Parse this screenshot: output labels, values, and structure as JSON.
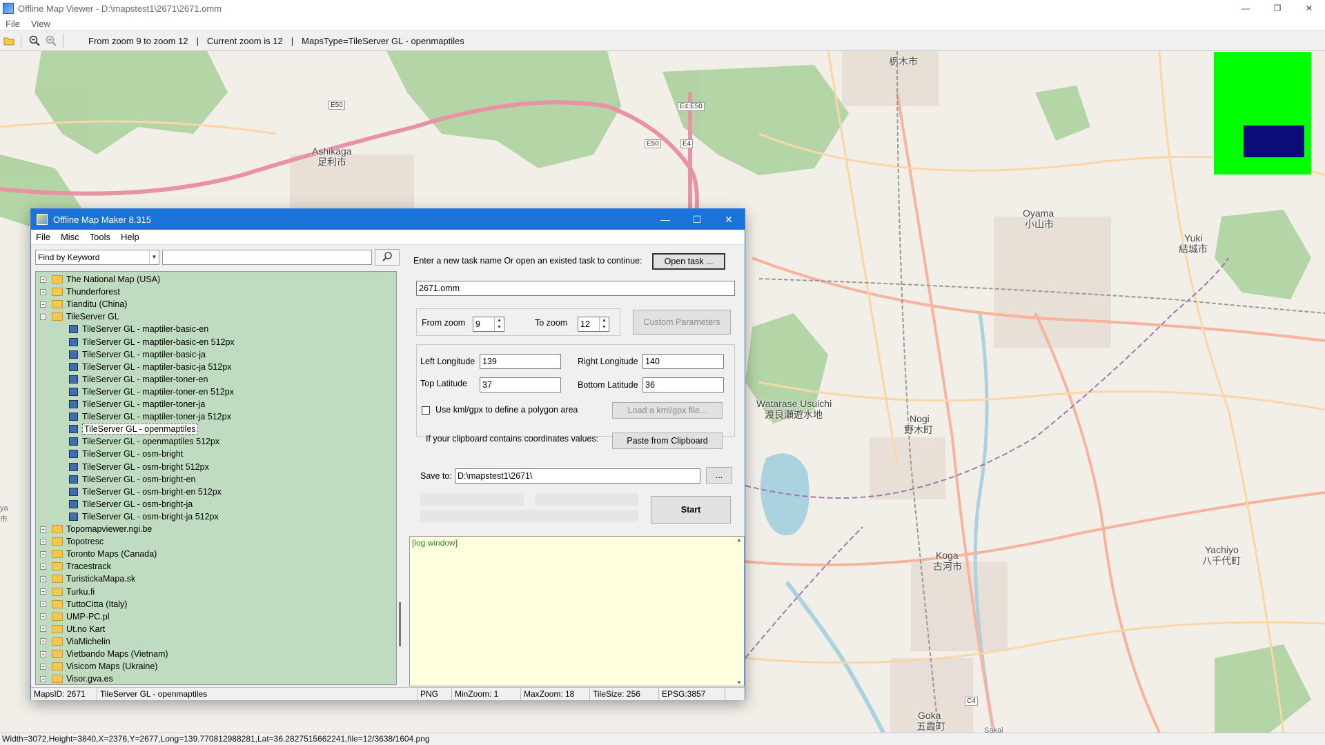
{
  "window": {
    "title": "Offline Map Viewer - D:\\mapstest1\\2671\\2671.omm",
    "controls": [
      "—",
      "❐",
      "✕"
    ]
  },
  "menubar": {
    "items": [
      "File",
      "View"
    ]
  },
  "toolbar": {
    "zoom_range": "From zoom 9 to zoom 12",
    "current_zoom": "Current zoom is 12",
    "maps_type": "MapsType=TileServer GL - openmaptiles",
    "separator": "|"
  },
  "map_labels": {
    "ashikaga": "Ashikaga",
    "ashikaga_jp": "足利市",
    "tochigi_jp": "栃木市",
    "oyama": "Oyama",
    "oyama_jp": "小山市",
    "yuki": "Yuki",
    "yuki_jp": "結城市",
    "watarase": "Watarase Usuichi",
    "watarase_jp": "渡良瀬遊水地",
    "nogi": "Nogi",
    "nogi_jp": "野木町",
    "koga": "Koga",
    "koga_jp": "古河市",
    "yachiyo": "Yachiyo",
    "yachiyo_jp": "八千代町",
    "goka": "Goka",
    "goka_jp": "五霞町",
    "sakai": "Sakai",
    "e50a": "E50",
    "e50b": "E50",
    "e4e50": "E4;E50",
    "e4": "E4",
    "c4": "C4",
    "ya": "ya",
    "shi": "市"
  },
  "statusbar": {
    "text": "Width=3072,Height=3840,X=2376,Y=2677,Long=139.770812988281,Lat=36.2827515662241,file=12/3638/1604.png"
  },
  "dialog": {
    "title": "Offline Map Maker 8.315",
    "controls": [
      "—",
      "☐",
      "✕"
    ],
    "menu": [
      "File",
      "Misc",
      "Tools",
      "Help"
    ],
    "find_select": "Find by Keyword",
    "find_input": "",
    "tree": [
      {
        "type": "folder",
        "expanded": false,
        "label": "The National Map (USA)"
      },
      {
        "type": "folder",
        "expanded": false,
        "label": "Thunderforest"
      },
      {
        "type": "folder",
        "expanded": false,
        "label": "Tianditu (China)"
      },
      {
        "type": "folder",
        "expanded": true,
        "label": "TileServer GL"
      },
      {
        "type": "map",
        "label": "TileServer GL - maptiler-basic-en"
      },
      {
        "type": "map",
        "label": "TileServer GL - maptiler-basic-en 512px"
      },
      {
        "type": "map",
        "label": "TileServer GL - maptiler-basic-ja"
      },
      {
        "type": "map",
        "label": "TileServer GL - maptiler-basic-ja 512px"
      },
      {
        "type": "map",
        "label": "TileServer GL - maptiler-toner-en"
      },
      {
        "type": "map",
        "label": "TileServer GL - maptiler-toner-en 512px"
      },
      {
        "type": "map",
        "label": "TileServer GL - maptiler-toner-ja"
      },
      {
        "type": "map",
        "label": "TileServer GL - maptiler-toner-ja 512px"
      },
      {
        "type": "map",
        "label": "TileServer GL - openmaptiles",
        "selected": true
      },
      {
        "type": "map",
        "label": "TileServer GL - openmaptiles 512px"
      },
      {
        "type": "map",
        "label": "TileServer GL - osm-bright"
      },
      {
        "type": "map",
        "label": "TileServer GL - osm-bright 512px"
      },
      {
        "type": "map",
        "label": "TileServer GL - osm-bright-en"
      },
      {
        "type": "map",
        "label": "TileServer GL - osm-bright-en 512px"
      },
      {
        "type": "map",
        "label": "TileServer GL - osm-bright-ja"
      },
      {
        "type": "map",
        "label": "TileServer GL - osm-bright-ja 512px"
      },
      {
        "type": "folder",
        "expanded": false,
        "label": "Topomapviewer.ngi.be"
      },
      {
        "type": "folder",
        "expanded": false,
        "label": "Topotresc"
      },
      {
        "type": "folder",
        "expanded": false,
        "label": "Toronto Maps (Canada)"
      },
      {
        "type": "folder",
        "expanded": false,
        "label": "Tracestrack"
      },
      {
        "type": "folder",
        "expanded": false,
        "label": "TuristickaMapa.sk"
      },
      {
        "type": "folder",
        "expanded": false,
        "label": "Turku.fi"
      },
      {
        "type": "folder",
        "expanded": false,
        "label": "TuttoCitta (Italy)"
      },
      {
        "type": "folder",
        "expanded": false,
        "label": "UMP-PC.pl"
      },
      {
        "type": "folder",
        "expanded": false,
        "label": "Ut.no Kart"
      },
      {
        "type": "folder",
        "expanded": false,
        "label": "ViaMichelin"
      },
      {
        "type": "folder",
        "expanded": false,
        "label": "Vietbando Maps (Vietnam)"
      },
      {
        "type": "folder",
        "expanded": false,
        "label": "Visicom Maps (Ukraine)"
      },
      {
        "type": "folder",
        "expanded": false,
        "label": "Visor.gva.es"
      }
    ],
    "task_prompt": "Enter a new task name Or open an existed task to continue:",
    "open_task": "Open task ...",
    "task_name": "2671.omm",
    "from_zoom_label": "From zoom",
    "from_zoom": "9",
    "to_zoom_label": "To zoom",
    "to_zoom": "12",
    "custom_params": "Custom Parameters",
    "left_lon_label": "Left Longitude",
    "left_lon": "139",
    "right_lon_label": "Right Longitude",
    "right_lon": "140",
    "top_lat_label": "Top Latitude",
    "top_lat": "37",
    "bottom_lat_label": "Bottom Latitude",
    "bottom_lat": "36",
    "kml_check_label": "Use kml/gpx to define a polygon area",
    "load_kml": "Load a kml/gpx file...",
    "clipboard_label": "If your clipboard contains coordinates values:",
    "paste_clipboard": "Paste from Clipboard",
    "save_to_label": "Save to:",
    "save_to": "D:\\mapstest1\\2671\\",
    "browse": "...",
    "start": "Start",
    "log_text": "[log window]",
    "status": {
      "maps_id": "MapsID: 2671",
      "map_name": "TileServer GL - openmaptiles",
      "format": "PNG",
      "min_zoom": "MinZoom: 1",
      "max_zoom": "MaxZoom: 18",
      "tile_size": "TileSize: 256",
      "epsg": "EPSG:3857"
    }
  },
  "minimap": {
    "background": "#00ff00",
    "viewport": "#0b0b7a"
  }
}
